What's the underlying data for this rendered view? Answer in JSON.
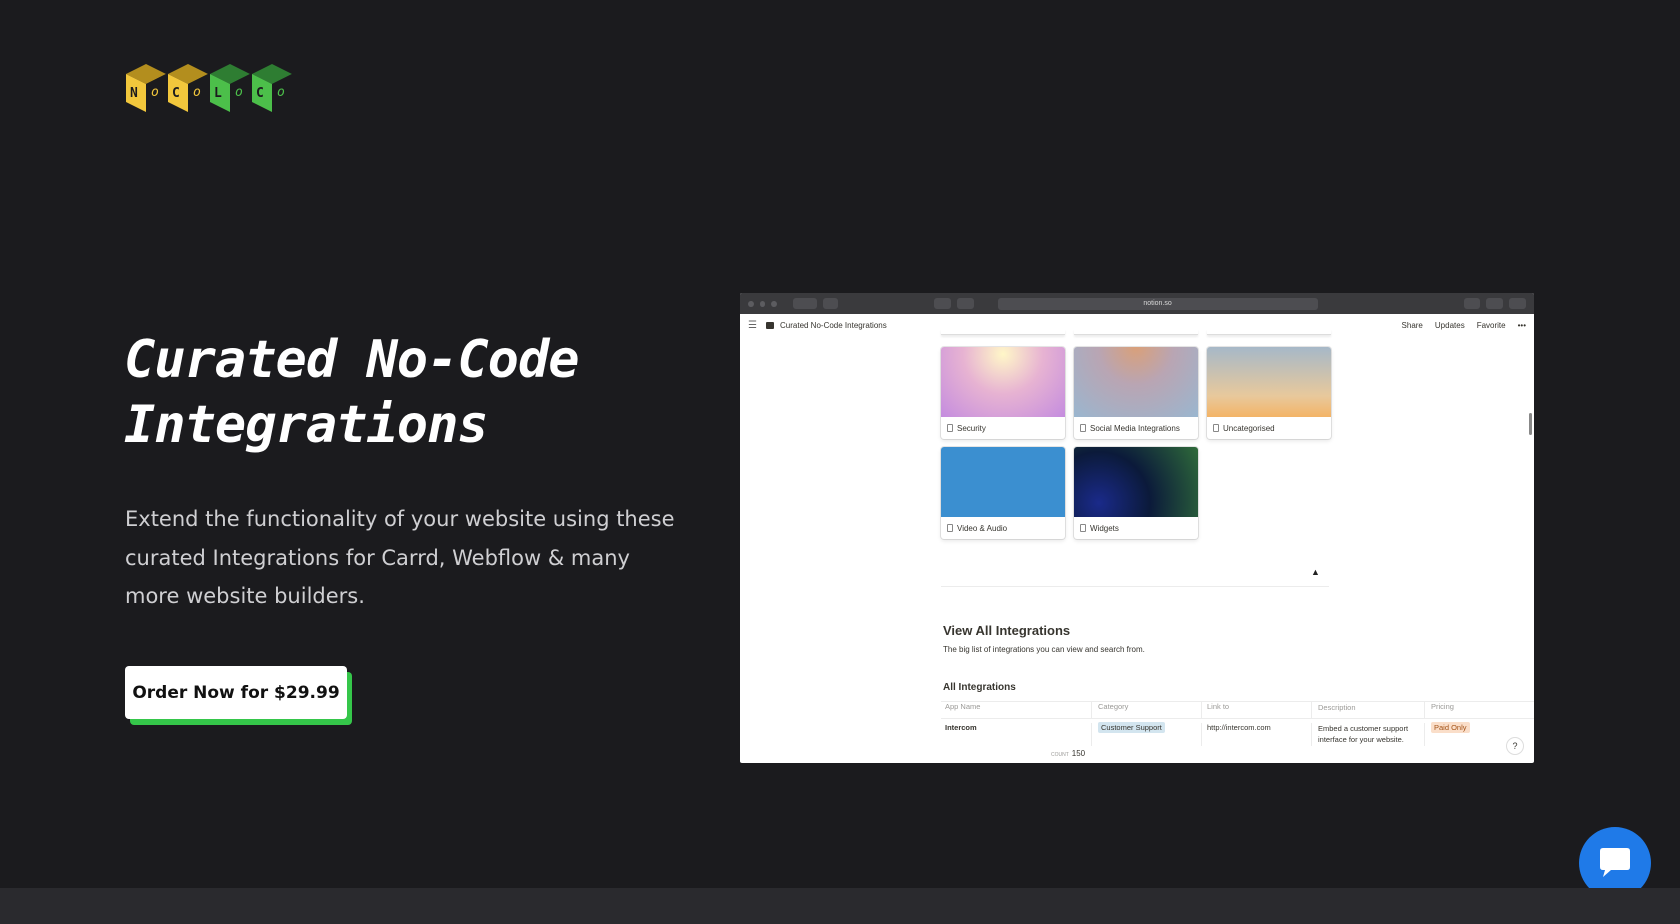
{
  "logo": {
    "alt": "NoCoLoCo",
    "cubes": [
      {
        "letter": "N",
        "small": "o",
        "color": "#f2c73c",
        "top": "#b38e1e"
      },
      {
        "letter": "C",
        "small": "o",
        "color": "#f2c73c",
        "top": "#b38e1e"
      },
      {
        "letter": "L",
        "small": "o",
        "color": "#4cbf4a",
        "top": "#2e7d32"
      },
      {
        "letter": "C",
        "small": "o",
        "color": "#4cbf4a",
        "top": "#2e7d32"
      }
    ]
  },
  "hero": {
    "title": "Curated No-Code Integrations",
    "subtitle": "Extend the functionality of your website using these curated Integrations for Carrd, Webflow & many more website builders.",
    "cta_label": "Order Now for $29.99"
  },
  "screenshot": {
    "url": "notion.so",
    "page_title": "Curated No-Code Integrations",
    "actions": [
      "Share",
      "Updates",
      "Favorite",
      "•••"
    ],
    "gallery": [
      {
        "label": "Security",
        "gradient": "radial-gradient(circle at 50% 10%, #fff7c8 0%, #e7b3d2 45%, #c48cdf 100%)"
      },
      {
        "label": "Social Media Integrations",
        "gradient": "radial-gradient(circle at 50% 0%, #d9a07a 0%, #b9a5b3 40%, #9ab6cf 100%)"
      },
      {
        "label": "Uncategorised",
        "gradient": "linear-gradient(180deg, #a6b8c8 0%, #e8c99c 70%, #f3b466 100%)"
      },
      {
        "label": "Video & Audio",
        "gradient": "linear-gradient(180deg, #3b8fd0 0%, #3b8fd0 100%)"
      },
      {
        "label": "Widgets",
        "gradient": "radial-gradient(circle at 20% 80%, #1a2a8a 0%, #0b1a3a 45%, #2f6b3a 100%)"
      }
    ],
    "view_all_title": "View All Integrations",
    "view_all_desc": "The big list of integrations you can view and search from.",
    "table_title": "All Integrations",
    "columns": [
      "App Name",
      "Category",
      "Link to",
      "Description",
      "Pricing"
    ],
    "row": {
      "app": "Intercom",
      "category": "Customer Support",
      "link": "http://intercom.com",
      "description": "Embed a customer support interface for your website.",
      "pricing": "Paid Only"
    },
    "count_label": "COUNT",
    "count_value": "150",
    "help": "?"
  },
  "chat": {
    "icon": "chat-bubble-icon",
    "color": "#1f7ae8"
  }
}
